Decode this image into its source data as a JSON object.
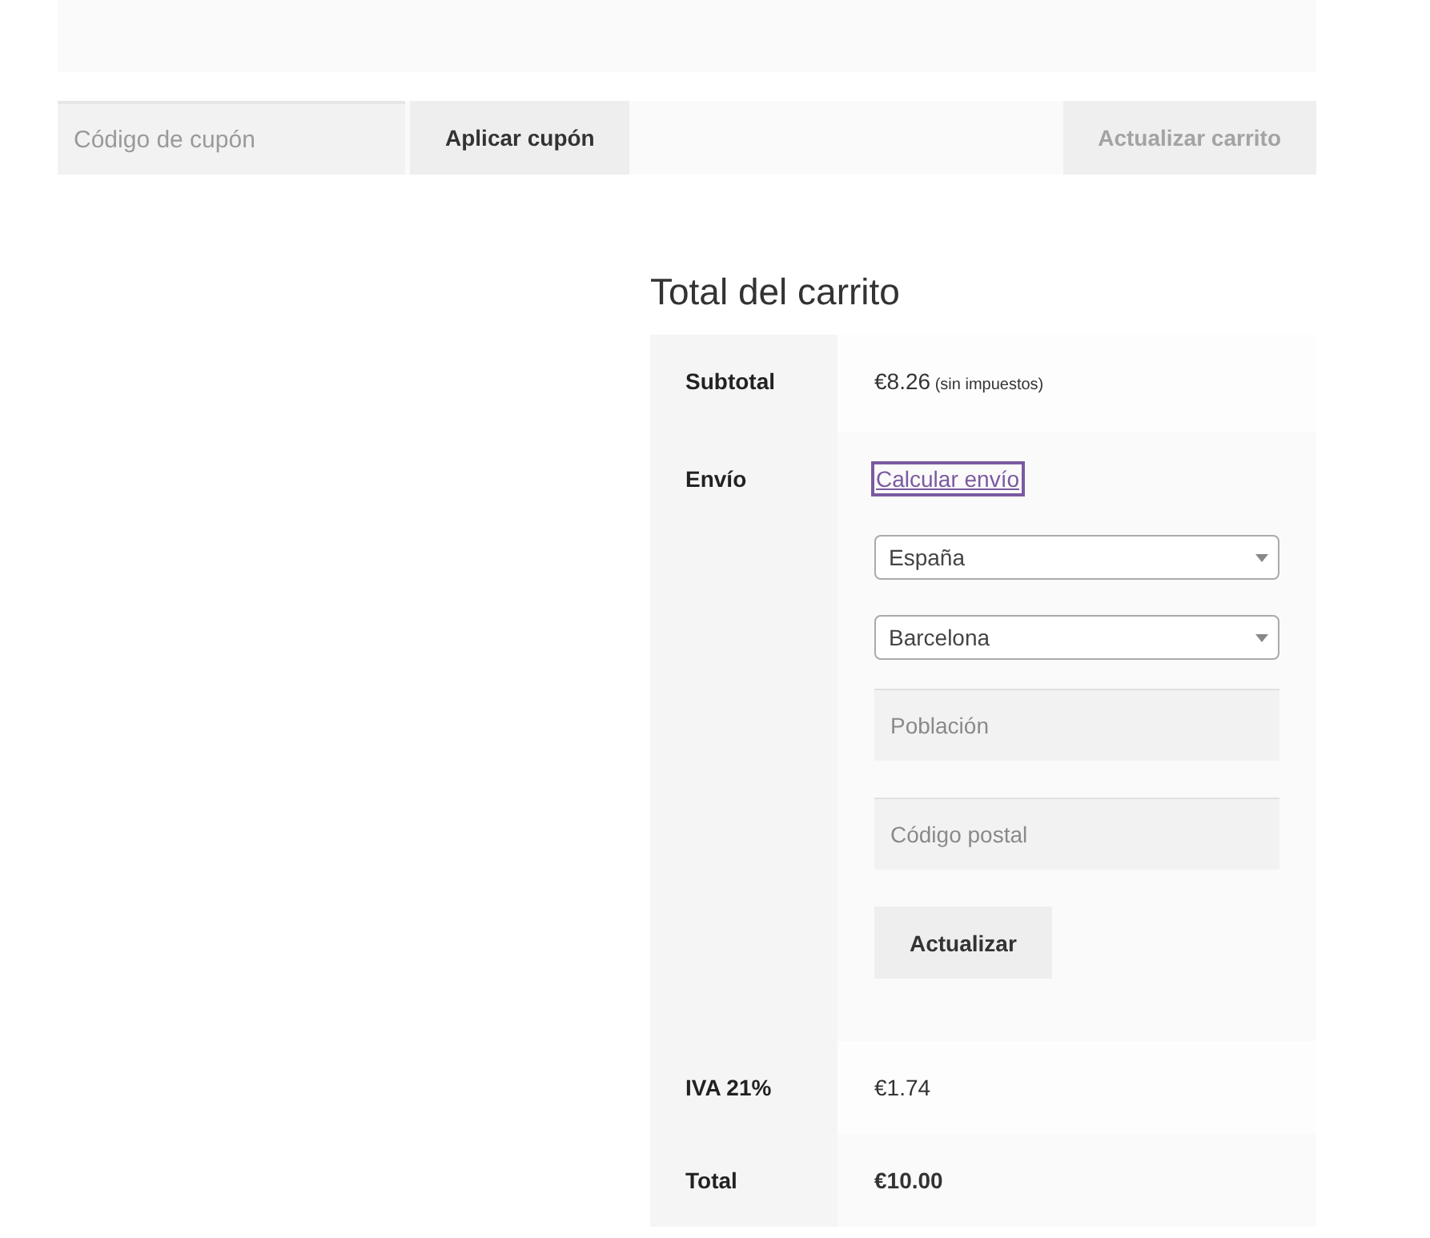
{
  "coupon": {
    "placeholder": "Código de cupón",
    "apply_label": "Aplicar cupón"
  },
  "update_cart_button": {
    "label": "Actualizar carrito",
    "disabled": true
  },
  "cart_totals": {
    "title": "Total del carrito",
    "rows": [
      {
        "kind": "amount",
        "label": "Subtotal",
        "value": "€8.26",
        "note": "(sin impuestos)"
      },
      {
        "kind": "shipping",
        "label": "Envío",
        "link": {
          "label": "Calcular envío",
          "focused": true
        },
        "country": "España",
        "state": "Barcelona",
        "city_placeholder": "Población",
        "postcode_placeholder": "Código postal",
        "button": "Actualizar"
      },
      {
        "kind": "amount",
        "label": "IVA 21%",
        "value": "€1.74"
      },
      {
        "kind": "total",
        "label": "Total",
        "value": "€10.00"
      }
    ]
  }
}
